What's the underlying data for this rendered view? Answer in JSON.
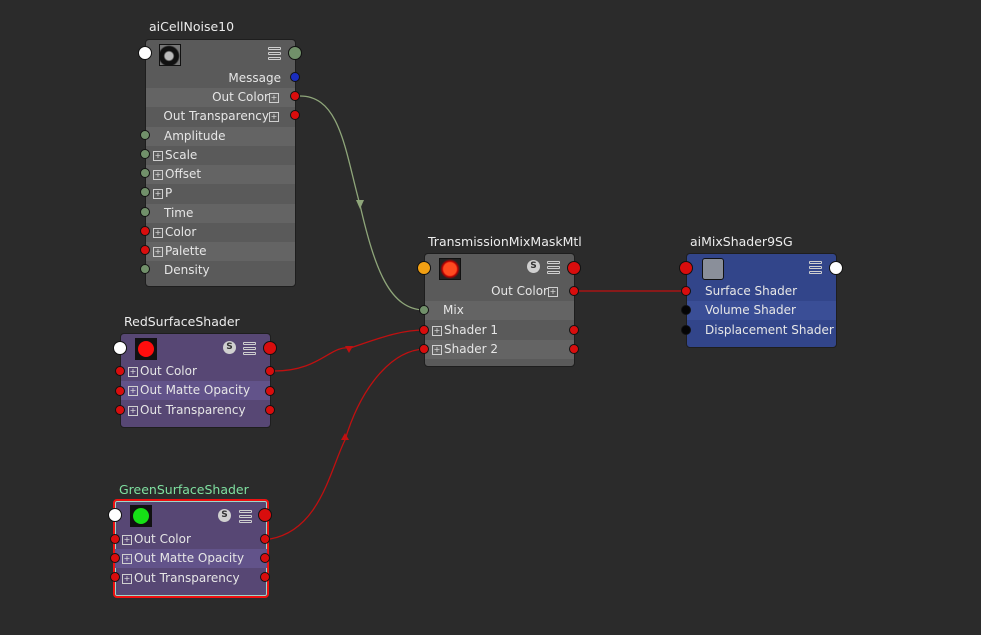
{
  "nodes": {
    "cellnoise": {
      "title": "aiCellNoise10",
      "outputs": [
        "Message",
        "Out Color",
        "Out Transparency"
      ],
      "inputs": [
        "Amplitude",
        "Scale",
        "Offset",
        "P",
        "Time",
        "Color",
        "Palette",
        "Density"
      ]
    },
    "transmission": {
      "title": "TransmissionMixMaskMtl",
      "output": "Out Color",
      "inputs": [
        "Mix",
        "Shader 1",
        "Shader 2"
      ]
    },
    "mixsg": {
      "title": "aiMixShader9SG",
      "inputs": [
        "Surface Shader",
        "Volume Shader",
        "Displacement Shader"
      ]
    },
    "red": {
      "title": "RedSurfaceShader",
      "attrs": [
        "Out Color",
        "Out Matte Opacity",
        "Out Transparency"
      ]
    },
    "green": {
      "title": "GreenSurfaceShader",
      "attrs": [
        "Out Color",
        "Out Matte Opacity",
        "Out Transparency"
      ]
    }
  },
  "icons": {
    "swatch_toggle": "S",
    "expand": "+"
  },
  "colors": {
    "background": "#2b2b2b",
    "wire_red": "#c01010",
    "wire_green": "#8fa67a",
    "selected_title": "#7fe0a0",
    "red_swatch": "#ff0d0d",
    "green_swatch": "#16e016"
  }
}
